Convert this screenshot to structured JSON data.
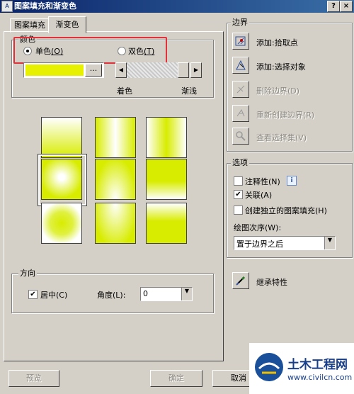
{
  "window": {
    "title": "图案填充和渐变色",
    "help_button": "?",
    "close_button": "×"
  },
  "tabs": [
    {
      "label": "图案填充",
      "active": false
    },
    {
      "label": "渐变色",
      "active": true
    }
  ],
  "color_group": {
    "legend": "颜色",
    "radio_single": {
      "label": "单色",
      "mnemonic": "(O)",
      "selected": true
    },
    "radio_double": {
      "label": "双色",
      "mnemonic": "(T)",
      "selected": false
    },
    "color_swatch": "#e6f000",
    "browse_button": "...",
    "slider_left_label": "着色",
    "slider_right_label": "渐浅",
    "colors": {
      "gradient_color": "#d8ec00",
      "highlight_box": "#e0323a"
    }
  },
  "gradient_patterns": [
    {
      "name": "linear",
      "selected": false
    },
    {
      "name": "cylinder",
      "selected": false
    },
    {
      "name": "inverted-cylinder",
      "selected": false
    },
    {
      "name": "spherical",
      "selected": true
    },
    {
      "name": "hemispherical",
      "selected": false
    },
    {
      "name": "curved",
      "selected": false
    },
    {
      "name": "inverted-spherical",
      "selected": false
    },
    {
      "name": "inverted-hemispherical",
      "selected": false
    },
    {
      "name": "inverted-curved",
      "selected": false
    }
  ],
  "direction_group": {
    "legend": "方向",
    "centered": {
      "label": "居中",
      "mnemonic": "(C)",
      "checked": true
    },
    "angle_label": "角度",
    "angle_mnemonic": "(L)",
    "angle_value": "0"
  },
  "boundary_group": {
    "legend": "边界",
    "buttons": [
      {
        "label": "添加:拾取点",
        "enabled": true
      },
      {
        "label": "添加:选择对象",
        "enabled": true
      },
      {
        "label": "删除边界",
        "mnemonic": "(D)",
        "enabled": false
      },
      {
        "label": "重新创建边界",
        "mnemonic": "(R)",
        "enabled": false
      },
      {
        "label": "查看选择集",
        "mnemonic": "(V)",
        "enabled": false
      }
    ]
  },
  "options_group": {
    "legend": "选项",
    "annotative": {
      "label": "注释性",
      "mnemonic": "(N)",
      "checked": false,
      "info": "i"
    },
    "associative": {
      "label": "关联",
      "mnemonic": "(A)",
      "checked": true
    },
    "separate": {
      "label": "创建独立的图案填充",
      "mnemonic": "(H)",
      "checked": false
    },
    "draw_order_label": "绘图次序",
    "draw_order_mnemonic": "(W):",
    "draw_order_value": "置于边界之后"
  },
  "inherit_button": {
    "label": "继承特性"
  },
  "footer": {
    "preview": "预览",
    "ok": "确定",
    "cancel": "取消"
  },
  "watermark": {
    "brand": "土木工程网",
    "url": "www.civilcn.com"
  }
}
